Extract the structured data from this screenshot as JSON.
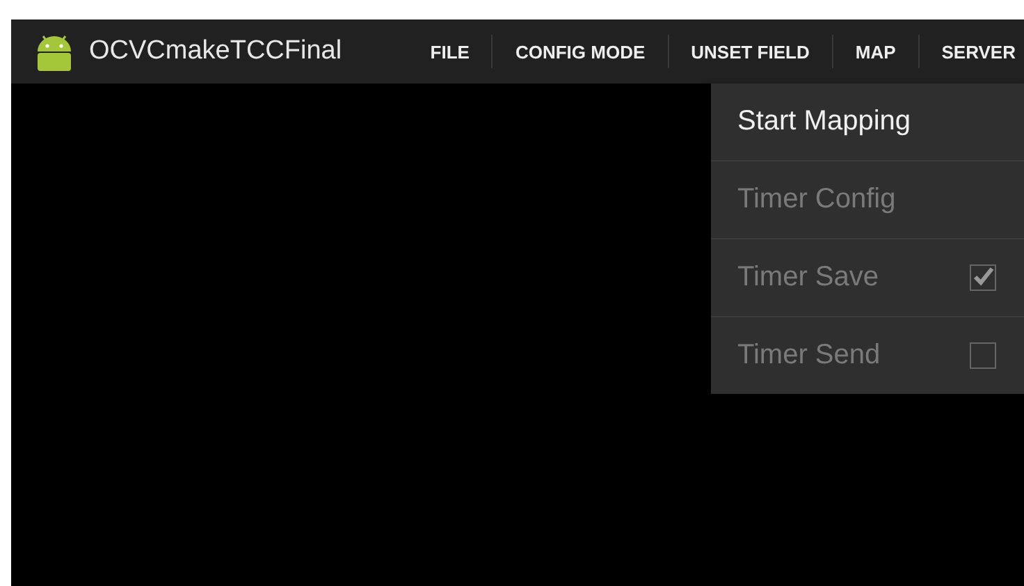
{
  "action_bar": {
    "title": "OCVCmakeTCCFinal",
    "actions": [
      {
        "label": "FILE"
      },
      {
        "label": "CONFIG MODE"
      },
      {
        "label": "UNSET FIELD"
      },
      {
        "label": "MAP"
      },
      {
        "label": "SERVER"
      }
    ]
  },
  "menu": {
    "items": [
      {
        "kind": "action",
        "label": "Start Mapping",
        "disabled": false
      },
      {
        "kind": "action",
        "label": "Timer Config",
        "disabled": true
      },
      {
        "kind": "checkbox",
        "label": "Timer Save",
        "disabled": true,
        "checked": true
      },
      {
        "kind": "checkbox",
        "label": "Timer Send",
        "disabled": true,
        "checked": false
      }
    ]
  }
}
